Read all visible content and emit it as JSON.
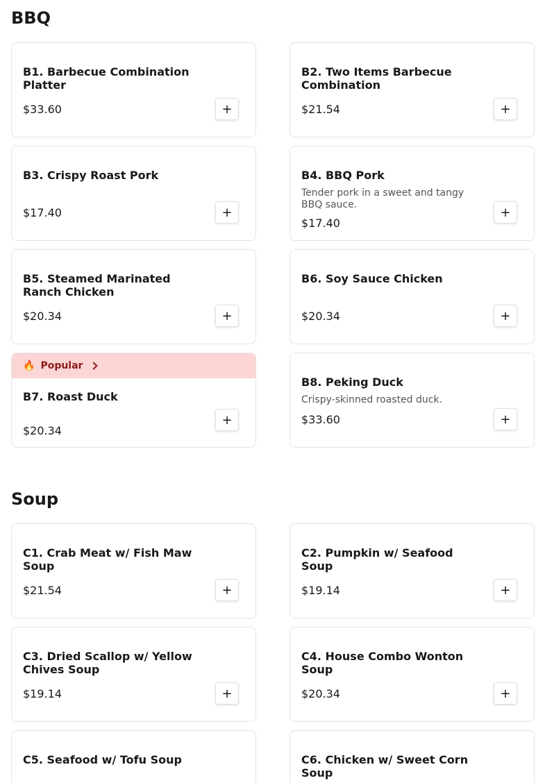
{
  "bbq": {
    "title": "BBQ",
    "items": [
      {
        "name": "B1. Barbecue Combination Platter",
        "price": "$33.60",
        "add": "+"
      },
      {
        "name": "B2. Two Items Barbecue Combination",
        "price": "$21.54",
        "add": "+"
      },
      {
        "name": "B3. Crispy Roast Pork",
        "price": "$17.40",
        "add": "+"
      },
      {
        "name": "B4. BBQ Pork",
        "desc": "Tender pork in a sweet and tangy BBQ sauce.",
        "price": "$17.40",
        "add": "+"
      },
      {
        "name": "B5. Steamed Marinated Ranch Chicken",
        "price": "$20.34",
        "add": "+"
      },
      {
        "name": "B6. Soy Sauce Chicken",
        "price": "$20.34",
        "add": "+"
      },
      {
        "name": "B7. Roast Duck",
        "price": "$20.34",
        "add": "+",
        "badge": {
          "icon": "🔥",
          "label": "Popular"
        }
      },
      {
        "name": "B8. Peking Duck",
        "desc": "Crispy-skinned roasted duck.",
        "price": "$33.60",
        "add": "+"
      }
    ]
  },
  "soup": {
    "title": "Soup",
    "items": [
      {
        "name": "C1. Crab Meat w/ Fish Maw Soup",
        "price": "$21.54",
        "add": "+"
      },
      {
        "name": "C2. Pumpkin w/ Seafood Soup",
        "price": "$19.14",
        "add": "+"
      },
      {
        "name": "C3. Dried Scallop w/ Yellow Chives Soup",
        "price": "$19.14",
        "add": "+"
      },
      {
        "name": "C4. House Combo Wonton Soup",
        "price": "$20.34",
        "add": "+"
      },
      {
        "name": "C5. Seafood w/ Tofu Soup"
      },
      {
        "name": "C6. Chicken w/ Sweet Corn Soup"
      }
    ]
  },
  "colors": {
    "popular_bg": "#fcd5d5",
    "popular_text": "#8b1a1a",
    "border": "#e4e4e4"
  }
}
